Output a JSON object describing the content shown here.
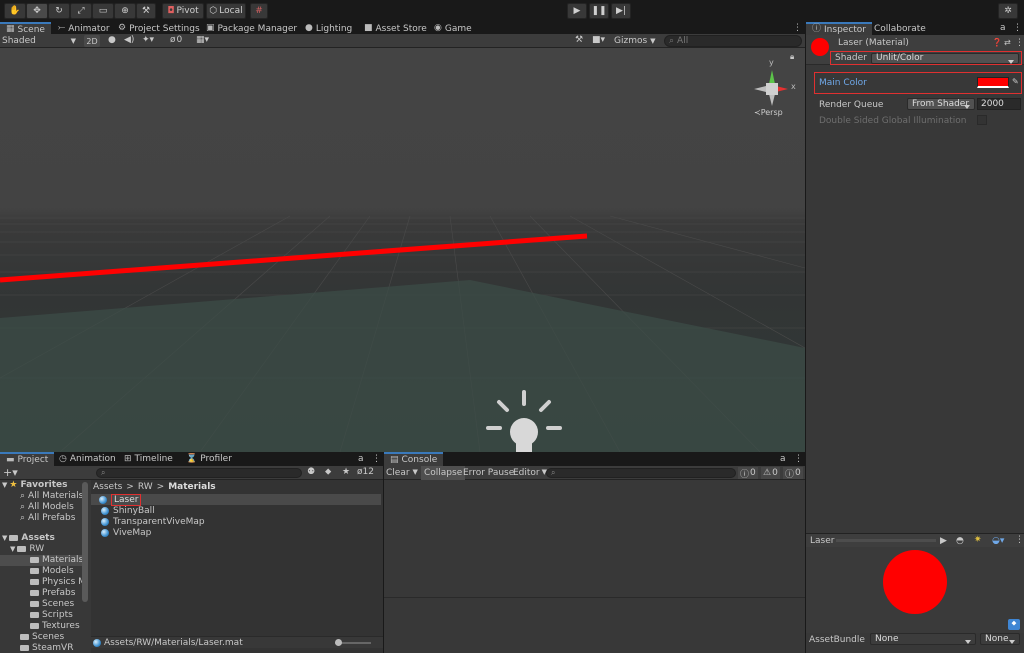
{
  "toolbar": {
    "pivot_label": "Pivot",
    "local_label": "Local"
  },
  "scene_tabs": {
    "scene": "Scene",
    "animator": "Animator",
    "project_settings": "Project Settings",
    "package_manager": "Package Manager",
    "lighting": "Lighting",
    "asset_store": "Asset Store",
    "game": "Game"
  },
  "scene_toolbar": {
    "shading": "Shaded",
    "mode_2d": "2D",
    "hidden_count": "0",
    "gizmos": "Gizmos",
    "search_placeholder": "All",
    "persp_label": "Persp",
    "axis_y": "y",
    "axis_x": "x"
  },
  "inspector": {
    "tab_inspector": "Inspector",
    "tab_collaborate": "Collaborate",
    "material_title": "Laser (Material)",
    "shader_label": "Shader",
    "shader_value": "Unlit/Color",
    "main_color_label": "Main Color",
    "main_color": "#ff0000",
    "render_queue_label": "Render Queue",
    "render_queue_mode": "From Shader",
    "render_queue_value": "2000",
    "double_sided_label": "Double Sided Global Illumination",
    "preview_title": "Laser",
    "asset_bundle_label": "AssetBundle",
    "asset_bundle_value": "None",
    "asset_bundle_variant": "None"
  },
  "project": {
    "tab_project": "Project",
    "tab_animation": "Animation",
    "tab_timeline": "Timeline",
    "tab_profiler": "Profiler",
    "hidden_count": "12",
    "favorites_label": "Favorites",
    "favorites": [
      "All Materials",
      "All Models",
      "All Prefabs"
    ],
    "assets_label": "Assets",
    "rw_label": "RW",
    "rw_folders": [
      "Materials",
      "Models",
      "Physics M",
      "Prefabs",
      "Scenes",
      "Scripts",
      "Textures"
    ],
    "scenes_label": "Scenes",
    "steamvr_label": "SteamVR",
    "breadcrumb": [
      "Assets",
      "RW",
      "Materials"
    ],
    "files": [
      "Laser",
      "ShinyBall",
      "TransparentViveMap",
      "ViveMap"
    ],
    "selected_path": "Assets/RW/Materials/Laser.mat"
  },
  "console": {
    "tab": "Console",
    "clear": "Clear",
    "collapse": "Collapse",
    "error_pause": "Error Pause",
    "editor": "Editor",
    "errors": "0",
    "warnings": "0",
    "logs": "0"
  },
  "colors": {
    "accent": "#3a79bb",
    "highlight": "#e03030",
    "laser": "#ff0000"
  }
}
